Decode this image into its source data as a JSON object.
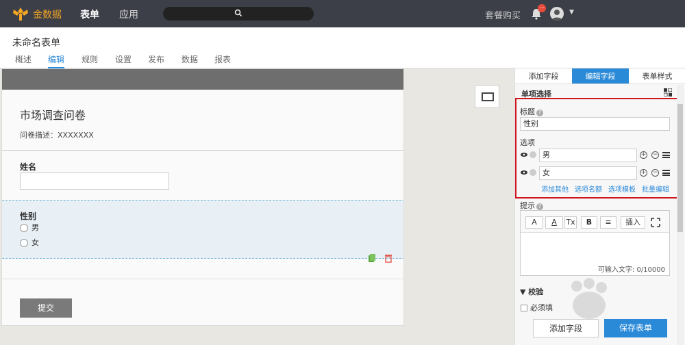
{
  "topbar": {
    "logo_text": "金数据",
    "nav": [
      "表单",
      "应用"
    ],
    "buy_label": "套餐购买",
    "badge": "···"
  },
  "header": {
    "form_name": "未命名表单",
    "tabs": [
      "概述",
      "编辑",
      "规则",
      "设置",
      "发布",
      "数据",
      "报表"
    ]
  },
  "canvas": {
    "title": "市场调查问卷",
    "description": "问卷描述：XXXXXXX",
    "name_label": "姓名",
    "gender_label": "性别",
    "options": [
      "男",
      "女"
    ],
    "submit_label": "提交"
  },
  "right_panel": {
    "tabs": [
      "添加字段",
      "编辑字段",
      "表单样式"
    ],
    "field_type": "单项选择",
    "title_label": "标题",
    "title_value": "性别",
    "options_label": "选项",
    "options": [
      "男",
      "女"
    ],
    "links": [
      "添加其他",
      "选项名额",
      "选项模板",
      "批量编辑"
    ],
    "hint_label": "提示",
    "toolbar": [
      "A",
      "A",
      "Tx",
      "B",
      "≡",
      "插入"
    ],
    "char_count": "可输入文字: 0/10000",
    "validate_label": "校验",
    "required_label": "必须填",
    "add_field_button": "添加字段",
    "save_button": "保存表单"
  },
  "colors": {
    "accent": "#2b8ad8",
    "topbar": "#3c3f48",
    "highlight_box": "#d0151c",
    "save": "#2b8ad8"
  }
}
